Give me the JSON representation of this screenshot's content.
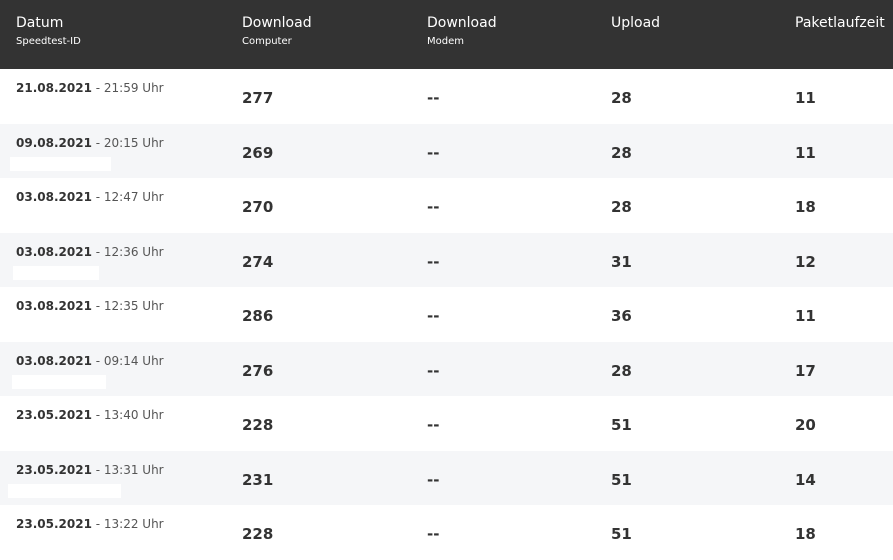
{
  "header": {
    "columns": [
      {
        "label": "Datum",
        "sub": "Speedtest-ID"
      },
      {
        "label": "Download",
        "sub": "Computer"
      },
      {
        "label": "Download",
        "sub": "Modem"
      },
      {
        "label": "Upload",
        "sub": ""
      },
      {
        "label": "Paketlaufzeit",
        "sub": ""
      }
    ]
  },
  "rows": [
    {
      "date": "21.08.2021",
      "sep": " - ",
      "time": "21:59 Uhr",
      "download_computer": "277",
      "download_modem": "--",
      "upload": "28",
      "latency": "11"
    },
    {
      "date": "09.08.2021",
      "sep": " - ",
      "time": "20:15 Uhr",
      "download_computer": "269",
      "download_modem": "--",
      "upload": "28",
      "latency": "11"
    },
    {
      "date": "03.08.2021",
      "sep": " - ",
      "time": "12:47 Uhr",
      "download_computer": "270",
      "download_modem": "--",
      "upload": "28",
      "latency": "18"
    },
    {
      "date": "03.08.2021",
      "sep": " - ",
      "time": "12:36 Uhr",
      "download_computer": "274",
      "download_modem": "--",
      "upload": "31",
      "latency": "12"
    },
    {
      "date": "03.08.2021",
      "sep": " - ",
      "time": "12:35 Uhr",
      "download_computer": "286",
      "download_modem": "--",
      "upload": "36",
      "latency": "11"
    },
    {
      "date": "03.08.2021",
      "sep": " - ",
      "time": "09:14 Uhr",
      "download_computer": "276",
      "download_modem": "--",
      "upload": "28",
      "latency": "17"
    },
    {
      "date": "23.05.2021",
      "sep": " - ",
      "time": "13:40 Uhr",
      "download_computer": "228",
      "download_modem": "--",
      "upload": "51",
      "latency": "20"
    },
    {
      "date": "23.05.2021",
      "sep": " - ",
      "time": "13:31 Uhr",
      "download_computer": "231",
      "download_modem": "--",
      "upload": "51",
      "latency": "14"
    },
    {
      "date": "23.05.2021",
      "sep": " - ",
      "time": "13:22 Uhr",
      "download_computer": "228",
      "download_modem": "--",
      "upload": "51",
      "latency": "18"
    }
  ],
  "colors": {
    "header_bg": "#333333",
    "header_text": "#ffffff",
    "row_alt_bg": "#f5f6f8",
    "text": "#333333"
  }
}
